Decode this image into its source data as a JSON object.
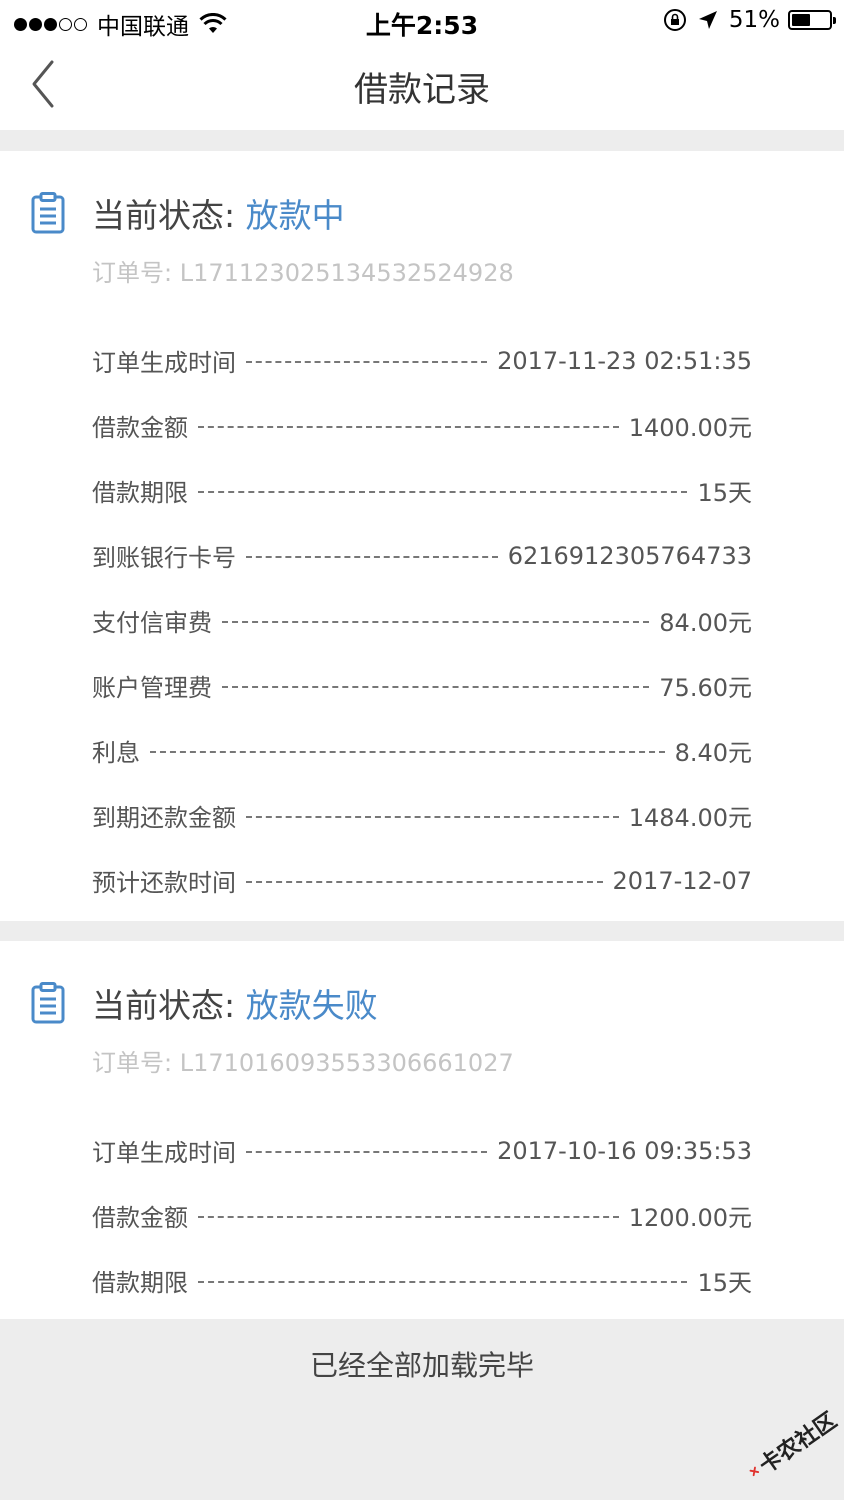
{
  "status_bar": {
    "carrier": "中国联通",
    "time": "上午2:53",
    "battery": "51%",
    "battery_level": 0.51
  },
  "nav": {
    "title": "借款记录"
  },
  "records": [
    {
      "status_label": "当前状态: ",
      "status_value": "放款中",
      "order_no": "订单号: L17112302513453252492​8",
      "rows": [
        {
          "label": "订单生成时间",
          "value": "2017-11-23 02:51:35"
        },
        {
          "label": "借款金额",
          "value": "1400.00元"
        },
        {
          "label": "借款期限",
          "value": "15天"
        },
        {
          "label": "到账银行卡号",
          "value": "6216912305764733"
        },
        {
          "label": "支付信审费",
          "value": "84.00元"
        },
        {
          "label": "账户管理费",
          "value": "75.60元"
        },
        {
          "label": "利息",
          "value": "8.40元"
        },
        {
          "label": "到期还款金额",
          "value": "1484.00元"
        },
        {
          "label": "预计还款时间",
          "value": "2017-12-07"
        }
      ]
    },
    {
      "status_label": "当前状态: ",
      "status_value": "放款失败",
      "order_no": "订单号: L17101609355330666102​7",
      "rows": [
        {
          "label": "订单生成时间",
          "value": "2017-10-16 09:35:53"
        },
        {
          "label": "借款金额",
          "value": "1200.00元"
        },
        {
          "label": "借款期限",
          "value": "15天"
        }
      ]
    }
  ],
  "footer": {
    "text": "已经全部加载完毕"
  },
  "watermark": {
    "text": "卡农社区"
  },
  "colors": {
    "accent": "#4a8ac9",
    "background": "#ededed",
    "order_no": "#c4c4c4"
  }
}
